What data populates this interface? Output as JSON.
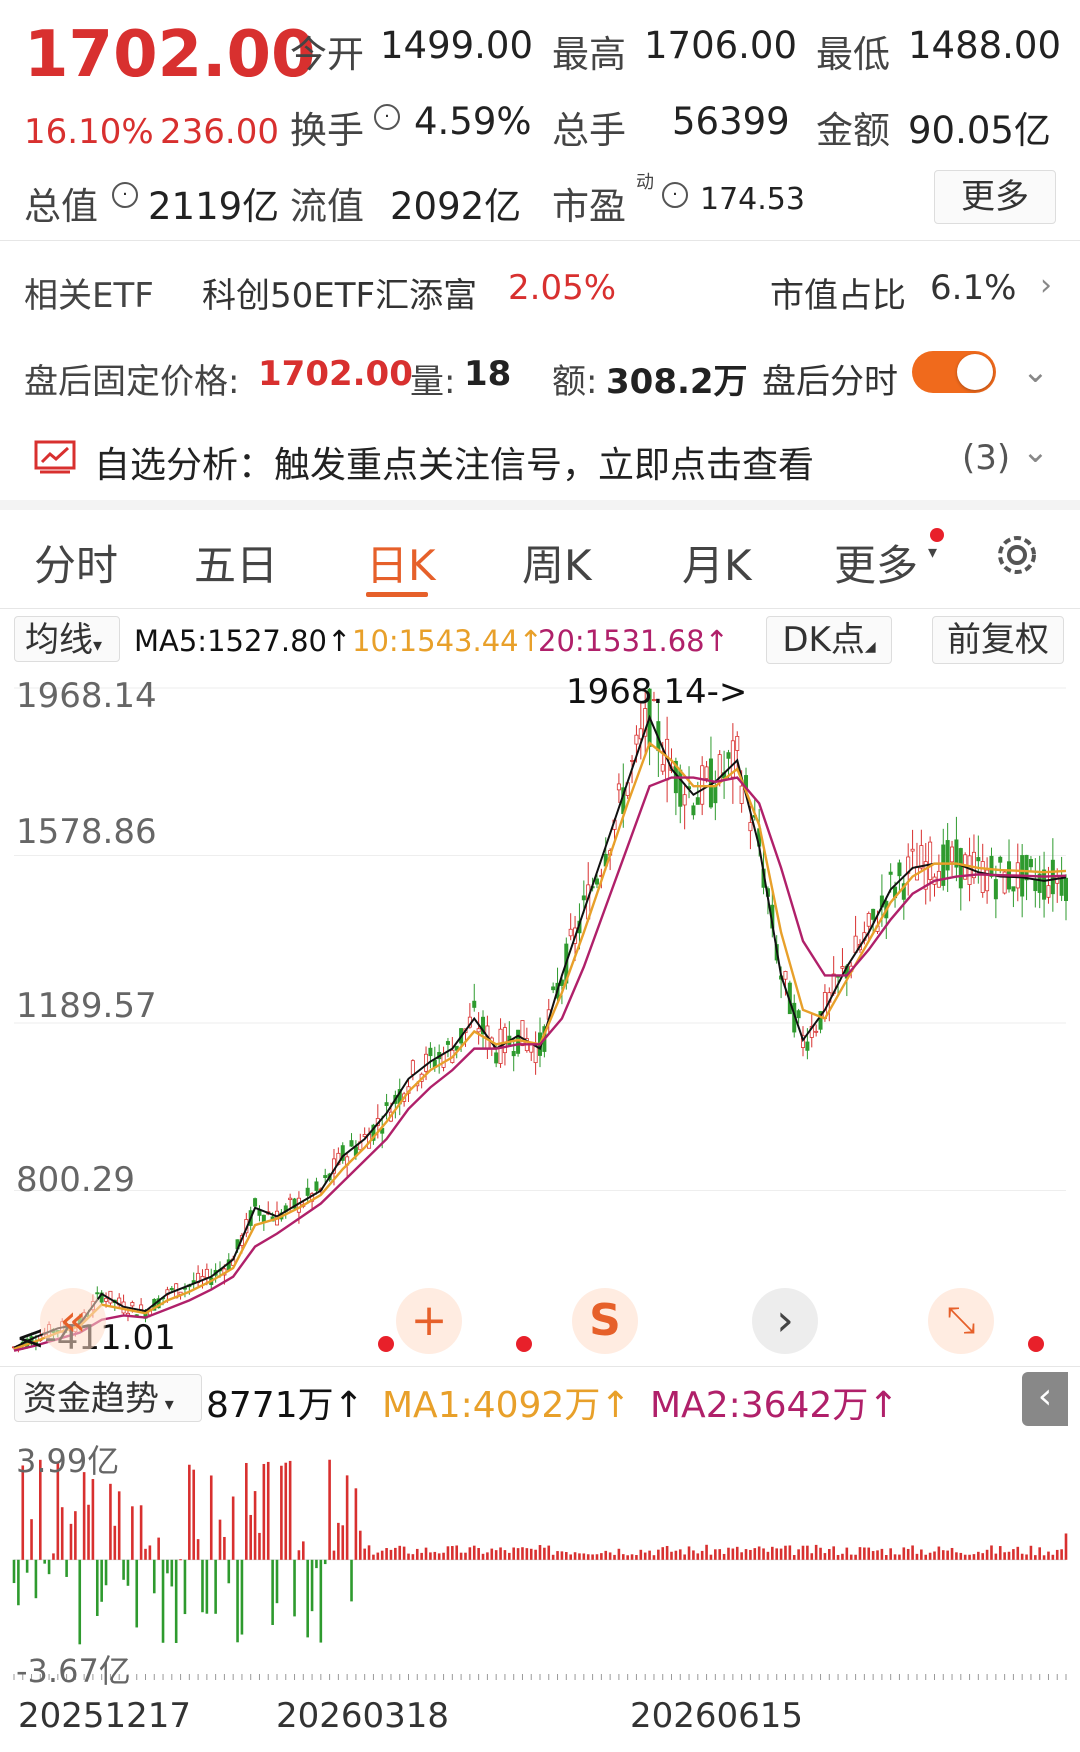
{
  "quote": {
    "price": "1702.00",
    "change_pct": "16.10%",
    "change_amt": "236.00",
    "open": {
      "label": "今开",
      "value": "1499.00"
    },
    "high": {
      "label": "最高",
      "value": "1706.00"
    },
    "low": {
      "label": "最低",
      "value": "1488.00"
    },
    "turnover": {
      "label": "换手",
      "value": "4.59%"
    },
    "volume": {
      "label": "总手",
      "value": "56399"
    },
    "amount": {
      "label": "金额",
      "value": "90.05亿"
    },
    "market_cap": {
      "label": "总值",
      "value": "2119亿"
    },
    "float_cap": {
      "label": "流值",
      "value": "2092亿"
    },
    "pe": {
      "label": "市盈",
      "sup": "动",
      "value": "174.53"
    },
    "more_button": "更多"
  },
  "etf": {
    "label": "相关ETF",
    "name": "科创50ETF汇添富",
    "pct": "2.05%",
    "share_label": "市值占比",
    "share_value": "6.1%"
  },
  "after_hours": {
    "price_label": "盘后固定价格:",
    "price": "1702.00",
    "vol_label": "量:",
    "vol": "18",
    "amt_label": "额:",
    "amt": "308.2万",
    "timeline_label": "盘后分时"
  },
  "analysis": {
    "text": "自选分析：触发重点关注信号，立即点击查看",
    "count": "(3)"
  },
  "tabs": [
    "分时",
    "五日",
    "日K",
    "周K",
    "月K",
    "更多"
  ],
  "active_tab": 2,
  "indicator_bar": {
    "selector": "均线",
    "ma5": "MA5:1527.80",
    "ma10": "10:1543.44",
    "ma20": "20:1531.68",
    "dk": "DK点",
    "adjust": "前复权"
  },
  "price_axis": {
    "labels": [
      "1968.14",
      "1578.86",
      "1189.57",
      "800.29"
    ],
    "high_marker": "1968.14->",
    "low_marker": "<-411.01"
  },
  "fund_bar": {
    "selector": "资金趋势",
    "value": "8771万",
    "ma1": "MA1:4092万",
    "ma2": "MA2:3642万"
  },
  "fund_axis": {
    "top": "3.99亿",
    "bottom": "-3.67亿"
  },
  "dates": [
    "20251217",
    "20260318",
    "20260615"
  ],
  "colors": {
    "up": "#d8302f",
    "down": "#2e9a2e",
    "ma5": "#111111",
    "ma10": "#e8a02a",
    "ma20": "#b0206a",
    "accent": "#e6602a"
  },
  "chart_data": {
    "type": "line",
    "title": "",
    "ylim": [
      411.01,
      1968.14
    ],
    "y_ticks": [
      1968.14,
      1578.86,
      1189.57,
      800.29
    ],
    "x": [
      0,
      5,
      10,
      15,
      20,
      25,
      30,
      35,
      40,
      45,
      50,
      55,
      60,
      65,
      70,
      75,
      80,
      85,
      90,
      95,
      100,
      105,
      110,
      115,
      120,
      125,
      130,
      135,
      140,
      145,
      150,
      155,
      160,
      165,
      170,
      175,
      180,
      185,
      190,
      195,
      200,
      205,
      210,
      215,
      220,
      225,
      230,
      235,
      240
    ],
    "series": [
      {
        "name": "MA5",
        "values": [
          435,
          460,
          480,
          490,
          560,
          530,
          520,
          560,
          580,
          600,
          640,
          760,
          740,
          770,
          800,
          880,
          920,
          980,
          1060,
          1100,
          1130,
          1200,
          1130,
          1160,
          1130,
          1300,
          1450,
          1600,
          1750,
          1900,
          1780,
          1720,
          1750,
          1800,
          1600,
          1300,
          1150,
          1220,
          1320,
          1400,
          1500,
          1550,
          1560,
          1560,
          1540,
          1530,
          1528,
          1520,
          1528
        ]
      },
      {
        "name": "10",
        "values": [
          432,
          450,
          470,
          485,
          535,
          525,
          515,
          545,
          565,
          590,
          620,
          720,
          735,
          760,
          790,
          850,
          900,
          960,
          1030,
          1080,
          1110,
          1170,
          1140,
          1150,
          1140,
          1260,
          1400,
          1550,
          1700,
          1840,
          1800,
          1740,
          1740,
          1780,
          1650,
          1400,
          1220,
          1200,
          1290,
          1380,
          1470,
          1530,
          1560,
          1560,
          1550,
          1545,
          1543,
          1540,
          1543
        ]
      },
      {
        "name": "20",
        "values": [
          428,
          440,
          455,
          470,
          500,
          510,
          505,
          525,
          545,
          570,
          600,
          670,
          700,
          735,
          770,
          820,
          870,
          920,
          990,
          1040,
          1080,
          1130,
          1130,
          1140,
          1140,
          1200,
          1320,
          1460,
          1600,
          1740,
          1760,
          1760,
          1750,
          1760,
          1700,
          1550,
          1380,
          1300,
          1300,
          1360,
          1430,
          1490,
          1520,
          1530,
          1535,
          1533,
          1532,
          1530,
          1532
        ]
      }
    ],
    "fund_flow": {
      "ylim": [
        -3.67,
        3.99
      ],
      "unit": "亿",
      "latest": 0.8771
    }
  }
}
